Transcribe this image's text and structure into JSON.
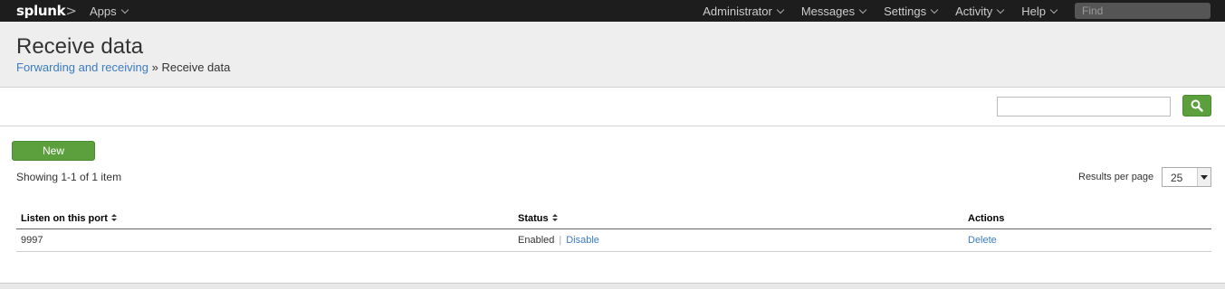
{
  "topbar": {
    "logo_text": "splunk",
    "logo_suffix": ">",
    "apps_label": "Apps",
    "menu": [
      "Administrator",
      "Messages",
      "Settings",
      "Activity",
      "Help"
    ],
    "find_placeholder": "Find"
  },
  "header": {
    "title": "Receive data",
    "breadcrumb_link": "Forwarding and receiving",
    "breadcrumb_sep": "»",
    "breadcrumb_current": "Receive data"
  },
  "toolbar": {
    "filter_value": ""
  },
  "content": {
    "new_button": "New",
    "showing": "Showing 1-1 of 1 item",
    "results_per_page_label": "Results per page",
    "results_per_page_value": "25"
  },
  "table": {
    "columns": [
      "Listen on this port",
      "Status",
      "Actions"
    ],
    "rows": [
      {
        "port": "9997",
        "status": "Enabled",
        "status_action": "Disable",
        "action": "Delete"
      }
    ]
  },
  "colors": {
    "topbar_bg": "#1d1d1d",
    "header_bg": "#eeeeee",
    "accent_green": "#5ba03c",
    "link_blue": "#3b7cc1"
  }
}
